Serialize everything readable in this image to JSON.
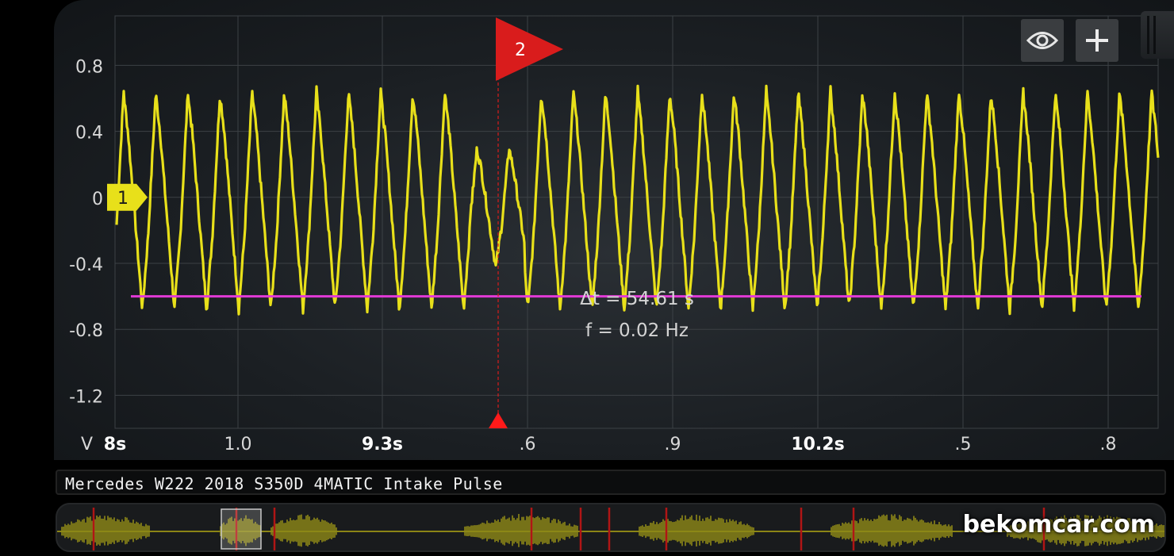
{
  "channel": {
    "label": "Mercedes W222 2018 S350D 4MATIC Intake Pulse"
  },
  "colors": {
    "trace": "#e8e01a",
    "marker": "#e8e01a",
    "cursor": "#d91c1c",
    "reference_line": "#e23ad6"
  },
  "y_axis": {
    "unit": "V",
    "ticks": [
      "0.8",
      "0.4",
      "0",
      "-0.4",
      "-0.8",
      "-1.2"
    ]
  },
  "x_axis": {
    "ticks": [
      {
        "label": "8s",
        "major": true
      },
      {
        "label": "1.0",
        "major": false
      },
      {
        "label": "9.3s",
        "major": true
      },
      {
        "label": ".6",
        "major": false
      },
      {
        "label": ".9",
        "major": false
      },
      {
        "label": "10.2s",
        "major": true
      },
      {
        "label": ".5",
        "major": false
      },
      {
        "label": ".8",
        "major": false
      }
    ]
  },
  "markers": {
    "channel_marker": "1",
    "trigger_marker": "2"
  },
  "measurement": {
    "delta_t": "Δt = 54.61 s",
    "frequency": "f = 0.02 Hz"
  },
  "toolbar": {
    "view_icon": "eye-icon",
    "add_icon": "plus-icon"
  },
  "chart_data": {
    "type": "line",
    "title": "",
    "xlabel": "",
    "ylabel": "V",
    "ylim": [
      -1.4,
      1.1
    ],
    "series": [
      {
        "waveform": "periodic intake pressure pulse",
        "peak_v": 0.58,
        "trough_v": -0.7,
        "cycles_visible": 36
      }
    ],
    "reference_line_v": -0.6,
    "grid": true
  },
  "watermark": "bekomcar.com"
}
